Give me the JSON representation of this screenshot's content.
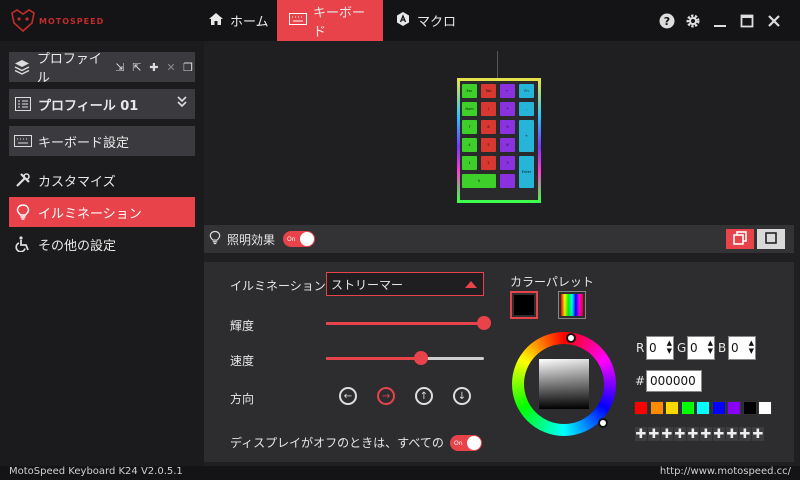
{
  "brand": {
    "logo_text": "MOTOSPEED",
    "accent": "#e8434a"
  },
  "nav": {
    "home": {
      "label": "ホーム",
      "icon": "home-icon"
    },
    "keyboard": {
      "label": "キーボード",
      "icon": "keyboard-icon",
      "active": true
    },
    "macro": {
      "label": "マクロ",
      "icon": "macro-icon"
    }
  },
  "window_controls": [
    "help-icon",
    "settings-icon",
    "minimize-icon",
    "maximize-icon",
    "close-icon"
  ],
  "sidebar": {
    "profile_files_label": "プロファイル",
    "profile_selected": "プロフィール 01",
    "keyboard_settings": "キーボード設定",
    "customize": "カスタマイズ",
    "illumination": "イルミネーション",
    "other_settings": "その他の設定"
  },
  "keyboard_preview": {
    "keys": [
      {
        "label": "Esc",
        "color": "#3ecf2a"
      },
      {
        "label": "Tab",
        "color": "#d8382f"
      },
      {
        "label": "←",
        "color": "#8a31e0"
      },
      {
        "label": "Fn",
        "color": "#26b4d8"
      },
      {
        "label": "Num",
        "color": "#3ecf2a"
      },
      {
        "label": "/",
        "color": "#d8382f"
      },
      {
        "label": "*",
        "color": "#8a31e0"
      },
      {
        "label": "-",
        "color": "#26b4d8"
      },
      {
        "label": "7",
        "color": "#3ecf2a"
      },
      {
        "label": "8",
        "color": "#d8382f"
      },
      {
        "label": "9",
        "color": "#8a31e0"
      },
      {
        "label": "4",
        "color": "#3ecf2a"
      },
      {
        "label": "5",
        "color": "#d8382f"
      },
      {
        "label": "6",
        "color": "#8a31e0"
      },
      {
        "label": "+",
        "color": "#26b4d8"
      },
      {
        "label": "1",
        "color": "#3ecf2a"
      },
      {
        "label": "2",
        "color": "#d8382f"
      },
      {
        "label": "3",
        "color": "#8a31e0"
      },
      {
        "label": "Enter",
        "color": "#26b4d8"
      },
      {
        "label": "0",
        "color": "#3ecf2a"
      },
      {
        "label": ".",
        "color": "#8a31e0"
      }
    ]
  },
  "lighting": {
    "header_label": "照明効果",
    "toggle_label": "On",
    "illumination_label": "イルミネーション",
    "effect_value": "ストリーマー",
    "brightness_label": "輝度",
    "brightness": 1.0,
    "speed_label": "速度",
    "speed": 0.6,
    "direction_label": "方向",
    "directions": [
      "left",
      "right",
      "up",
      "down"
    ],
    "direction_selected": "right",
    "display_off_label": "ディスプレイがオフのときは、すべての照",
    "display_off_toggle": "On"
  },
  "color": {
    "palette_label": "カラーパレット",
    "current_color": "#000000",
    "r_label": "R",
    "r_value": "0",
    "g_label": "G",
    "g_value": "0",
    "b_label": "B",
    "b_value": "0",
    "hash_label": "#",
    "hex_value": "000000",
    "swatches": [
      "#ff0000",
      "#ff8c00",
      "#ffd700",
      "#00ff00",
      "#00ffff",
      "#0000ff",
      "#8a00ff",
      "#000000",
      "#ffffff"
    ],
    "custom_slots": [
      "✚",
      "✚",
      "✚",
      "✚",
      "✚",
      "✚",
      "✚",
      "✚",
      "✚",
      "✚"
    ]
  },
  "status": {
    "version": "MotoSpeed Keyboard K24 V2.0.5.1",
    "url": "http://www.motospeed.cc/"
  }
}
